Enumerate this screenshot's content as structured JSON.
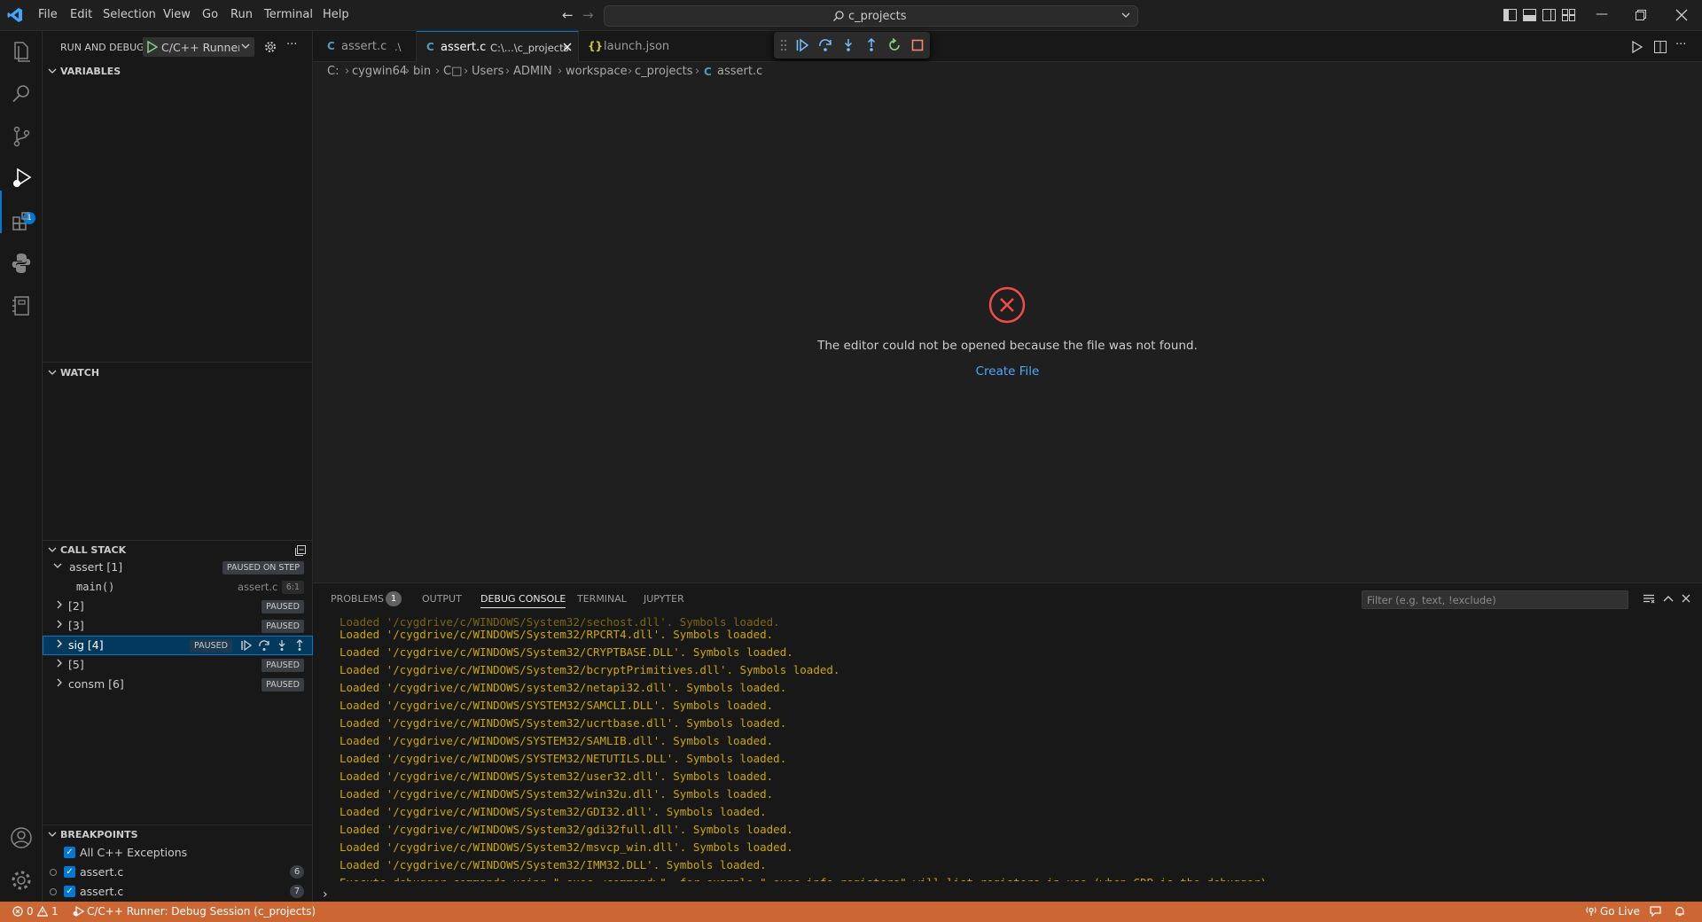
{
  "menu": [
    "File",
    "Edit",
    "Selection",
    "View",
    "Go",
    "Run",
    "Terminal",
    "Help"
  ],
  "command_center": {
    "text": "c_projects"
  },
  "sidebar": {
    "header": "RUN AND DEBUG",
    "config": "C/C++ Runner",
    "sections": {
      "variables": "VARIABLES",
      "watch": "WATCH",
      "call_stack": "CALL STACK",
      "breakpoints": "BREAKPOINTS"
    },
    "call_stack": {
      "assert": {
        "label": "assert [1]",
        "badge": "PAUSED ON STEP"
      },
      "frame": {
        "fn": "main()",
        "file": "assert.c",
        "pos": "6:1"
      },
      "t2": {
        "label": "[2]",
        "badge": "PAUSED"
      },
      "t3": {
        "label": "[3]",
        "badge": "PAUSED"
      },
      "sig": {
        "label": "sig [4]",
        "badge": "PAUSED"
      },
      "t5": {
        "label": "[5]",
        "badge": "PAUSED"
      },
      "consm": {
        "label": "consm [6]",
        "badge": "PAUSED"
      }
    },
    "breakpoints": {
      "exceptions": "All C++ Exceptions",
      "bp1": {
        "file": "assert.c",
        "line": "6"
      },
      "bp2": {
        "file": "assert.c",
        "line": "7"
      }
    }
  },
  "activity": {
    "debug_badge": "1"
  },
  "tabs": [
    {
      "label": "assert.c",
      "desc": ".\\"
    },
    {
      "label": "assert.c",
      "desc": "C:\\...\\c_projects"
    },
    {
      "label": "launch.json",
      "desc": ""
    }
  ],
  "breadcrumb": [
    "C:",
    "cygwin64",
    "bin",
    "C□",
    "Users",
    "ADMIN",
    "workspace",
    "c_projects",
    "assert.c"
  ],
  "editor": {
    "error_message": "The editor could not be opened because the file was not found.",
    "create_file": "Create File"
  },
  "panel": {
    "tabs": [
      "PROBLEMS",
      "OUTPUT",
      "DEBUG CONSOLE",
      "TERMINAL",
      "JUPYTER"
    ],
    "problems_count": "1",
    "filter_placeholder": "Filter (e.g. text, !exclude)",
    "console_lines": [
      "Loaded '/cygdrive/c/WINDOWS/System32/RPCRT4.dll'. Symbols loaded.",
      "Loaded '/cygdrive/c/WINDOWS/System32/CRYPTBASE.DLL'. Symbols loaded.",
      "Loaded '/cygdrive/c/WINDOWS/System32/bcryptPrimitives.dll'. Symbols loaded.",
      "Loaded '/cygdrive/c/WINDOWS/system32/netapi32.dll'. Symbols loaded.",
      "Loaded '/cygdrive/c/WINDOWS/SYSTEM32/SAMCLI.DLL'. Symbols loaded.",
      "Loaded '/cygdrive/c/WINDOWS/System32/ucrtbase.dll'. Symbols loaded.",
      "Loaded '/cygdrive/c/WINDOWS/SYSTEM32/SAMLIB.dll'. Symbols loaded.",
      "Loaded '/cygdrive/c/WINDOWS/SYSTEM32/NETUTILS.DLL'. Symbols loaded.",
      "Loaded '/cygdrive/c/WINDOWS/System32/user32.dll'. Symbols loaded.",
      "Loaded '/cygdrive/c/WINDOWS/System32/win32u.dll'. Symbols loaded.",
      "Loaded '/cygdrive/c/WINDOWS/System32/GDI32.dll'. Symbols loaded.",
      "Loaded '/cygdrive/c/WINDOWS/System32/gdi32full.dll'. Symbols loaded.",
      "Loaded '/cygdrive/c/WINDOWS/System32/msvcp_win.dll'. Symbols loaded.",
      "Loaded '/cygdrive/c/WINDOWS/System32/IMM32.DLL'. Symbols loaded.",
      "Execute debugger commands using \"-exec <command>\", for example \"-exec info registers\" will list registers in use (when GDB is the debugger)"
    ]
  },
  "status": {
    "errors": "0",
    "warnings": "1",
    "session": "C/C++ Runner: Debug Session (c_projects)",
    "go_live": "Go Live"
  },
  "colors": {
    "accent": "#0078d4",
    "status_bar": "#cc6633",
    "console_text": "#cca700",
    "error": "#f14c4c"
  }
}
